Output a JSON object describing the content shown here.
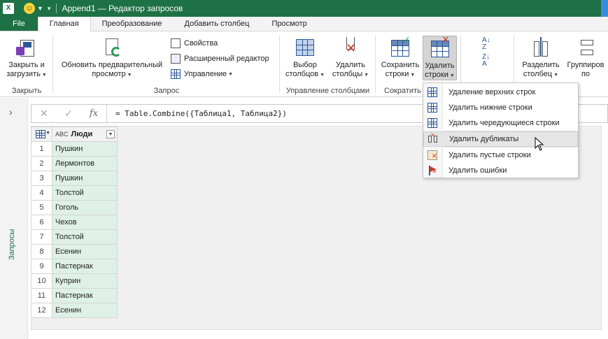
{
  "titlebar": {
    "app_icon": "X",
    "title": "Append1 — Редактор запросов"
  },
  "tabs": [
    {
      "label": "File"
    },
    {
      "label": "Главная"
    },
    {
      "label": "Преобразование"
    },
    {
      "label": "Добавить столбец"
    },
    {
      "label": "Просмотр"
    }
  ],
  "ribbon": {
    "close_group": {
      "label": "Закрыть",
      "close_load_line1": "Закрыть и",
      "close_load_line2": "загрузить"
    },
    "query_group": {
      "label": "Запрос",
      "refresh_line1": "Обновить предварительный",
      "refresh_line2": "просмотр",
      "properties": "Свойства",
      "advanced_editor": "Расширенный редактор",
      "manage": "Управление"
    },
    "columns_group": {
      "label": "Управление столбцами",
      "choose_line1": "Выбор",
      "choose_line2": "столбцов",
      "remove_line1": "Удалить",
      "remove_line2": "столбцы"
    },
    "reduce_group": {
      "label": "Сократить",
      "keep_line1": "Сохранить",
      "keep_line2": "строки",
      "remove_rows_line1": "Удалить",
      "remove_rows_line2": "строки"
    },
    "split_group": {
      "split_line1": "Разделить",
      "split_line2": "столбец",
      "group_line1": "Группиров",
      "group_line2": "по"
    }
  },
  "formula_bar": {
    "fx": "fx",
    "formula": "= Table.Combine({Таблица1, Таблица2})"
  },
  "left_pane": {
    "label": "Запросы"
  },
  "table": {
    "column_type": "ABC",
    "column_name": "Люди",
    "rows": [
      {
        "n": "1",
        "value": "Пушкин"
      },
      {
        "n": "2",
        "value": "Лермонтов"
      },
      {
        "n": "3",
        "value": "Пушкин"
      },
      {
        "n": "4",
        "value": "Толстой"
      },
      {
        "n": "5",
        "value": "Гоголь"
      },
      {
        "n": "6",
        "value": "Чехов"
      },
      {
        "n": "7",
        "value": "Толстой"
      },
      {
        "n": "8",
        "value": "Есенин"
      },
      {
        "n": "9",
        "value": "Пастернак"
      },
      {
        "n": "10",
        "value": "Куприн"
      },
      {
        "n": "11",
        "value": "Пастернак"
      },
      {
        "n": "12",
        "value": "Есенин"
      }
    ]
  },
  "menu": {
    "items": [
      {
        "label": "Удаление верхних строк",
        "icon": "remove-top-rows-icon"
      },
      {
        "label": "Удалить нижние строки",
        "icon": "remove-bottom-rows-icon"
      },
      {
        "label": "Удалить чередующиеся строки",
        "icon": "remove-alternate-rows-icon"
      },
      {
        "label": "Удалить дубликаты",
        "icon": "remove-duplicates-icon"
      },
      {
        "label": "Удалить пустые строки",
        "icon": "remove-blank-rows-icon"
      },
      {
        "label": "Удалить ошибки",
        "icon": "remove-errors-icon"
      }
    ]
  },
  "colors": {
    "brand": "#1e7145",
    "cell_bg": "#dff1e6",
    "accent_blue": "#2b579a"
  }
}
